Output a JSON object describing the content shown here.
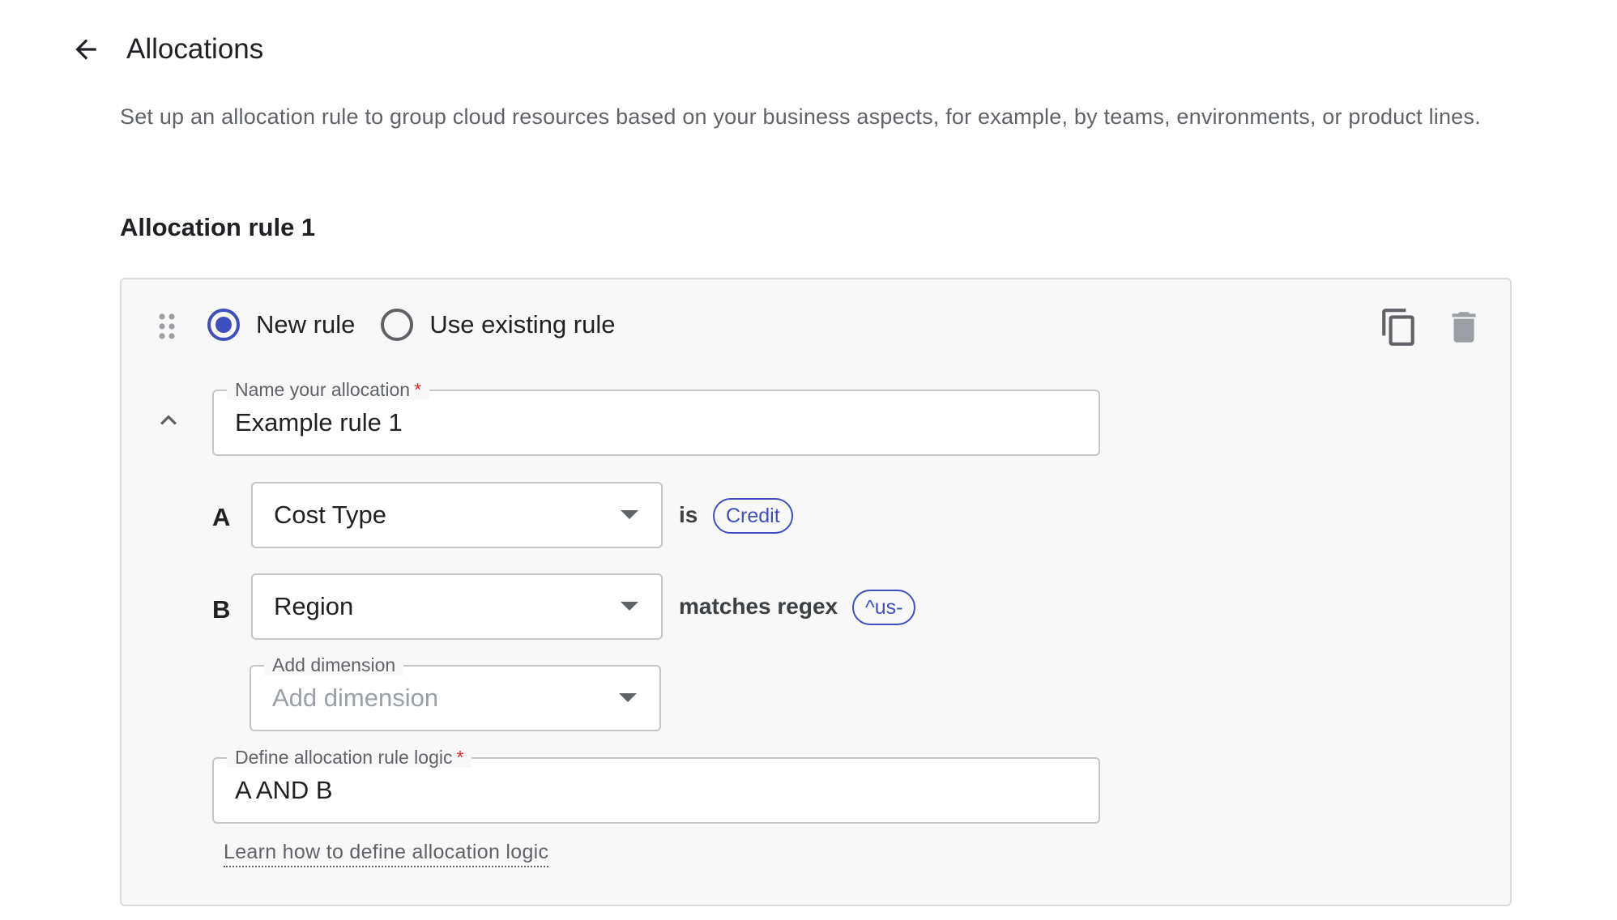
{
  "header": {
    "title": "Allocations",
    "back_icon": "arrow-back-icon"
  },
  "description": "Set up an allocation rule to group cloud resources based on your business aspects, for example, by teams, environments, or product lines.",
  "rule": {
    "heading": "Allocation rule 1",
    "radio_options": [
      {
        "label": "New rule",
        "selected": true
      },
      {
        "label": "Use existing rule",
        "selected": false
      }
    ],
    "actions": {
      "copy_icon": "copy-icon",
      "delete_icon": "delete-icon"
    },
    "name_field": {
      "label": "Name your allocation",
      "required_mark": "*",
      "value": "Example rule 1"
    },
    "conditions": [
      {
        "letter": "A",
        "dimension": "Cost Type",
        "operator": "is",
        "value": "Credit"
      },
      {
        "letter": "B",
        "dimension": "Region",
        "operator": "matches regex",
        "value": "^us-"
      }
    ],
    "add_dimension": {
      "label": "Add dimension",
      "placeholder": "Add dimension"
    },
    "logic_field": {
      "label": "Define allocation rule logic",
      "required_mark": "*",
      "value": "A AND B"
    },
    "learn_link": "Learn how to define allocation logic"
  },
  "colors": {
    "accent": "#3f4fc1",
    "required": "#d93025",
    "card_bg": "#f8f8f8",
    "border": "#c4c7c5"
  }
}
